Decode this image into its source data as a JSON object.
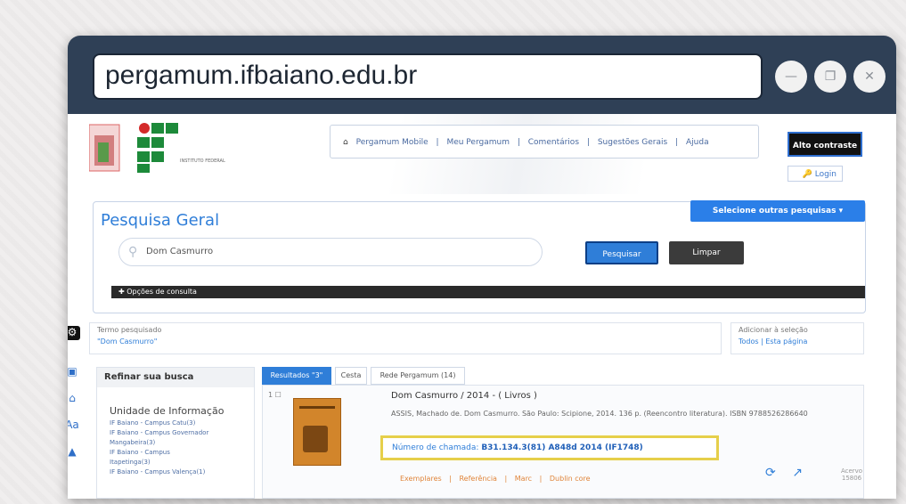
{
  "browser": {
    "url": "pergamum.ifbaiano.edu.br",
    "buttons": {
      "minimize": "—",
      "restore": "❐",
      "close": "✕"
    }
  },
  "header": {
    "logo_text": "INSTITUTO FEDERAL",
    "nav": [
      "Pergamum Mobile",
      "|",
      "Meu Pergamum",
      "|",
      "Comentários",
      "|",
      "Sugestões Gerais",
      "|",
      "Ajuda"
    ],
    "access_button": "Alto contraste",
    "login": "Login"
  },
  "search": {
    "title": "Pesquisa Geral",
    "select_others": "Selecione outras pesquisas",
    "query": "Dom Casmurro",
    "search_button": "Pesquisar",
    "clear_button": "Limpar",
    "options_label": "Opções de consulta"
  },
  "termo": {
    "label": "Termo pesquisado",
    "value": "\"Dom Casmurro\""
  },
  "adicionar": {
    "label": "Adicionar à seleção",
    "value": "Todos | Esta página"
  },
  "refinar": {
    "title": "Refinar sua busca",
    "unidade_title": "Unidade de Informação",
    "items": [
      "IF Baiano - Campus Catu(3)",
      "IF Baiano - Campus Governador",
      "Mangabeira(3)",
      "IF Baiano - Campus",
      "Itapetinga(3)",
      "IF Baiano - Campus Valença(1)"
    ]
  },
  "tabs": [
    "Resultados \"3\"",
    "Cesta",
    "Rede Pergamum (14)"
  ],
  "result": {
    "index": "1",
    "title": "Dom Casmurro / 2014 - ( Livros )",
    "description": "ASSIS, Machado de. Dom Casmurro. São Paulo: Scipione, 2014. 136 p. (Reencontro literatura). ISBN 9788526286640",
    "chamada_label": "Número de chamada:",
    "chamada_value": "B31.134.3(81) A848d 2014 (IF1748)",
    "links": [
      "Exemplares",
      "|",
      "Referência",
      "|",
      "Marc",
      "|",
      "Dublin core"
    ],
    "acervo": "Acervo 15806"
  }
}
